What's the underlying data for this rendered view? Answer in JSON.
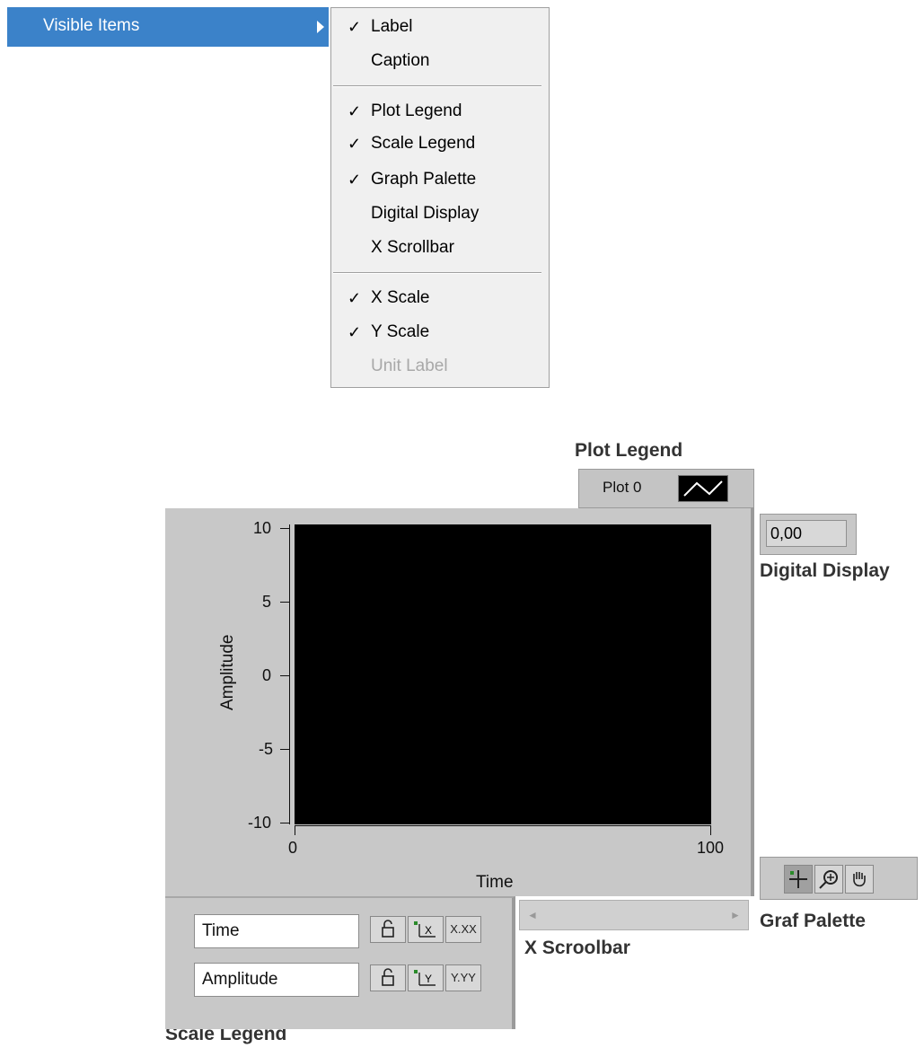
{
  "menu": {
    "parent_label": "Visible Items",
    "items": [
      {
        "label": "Label",
        "checked": true,
        "disabled": false
      },
      {
        "label": "Caption",
        "checked": false,
        "disabled": false
      },
      {
        "label": "Plot Legend",
        "checked": true,
        "disabled": false
      },
      {
        "label": "Scale Legend",
        "checked": true,
        "disabled": false
      },
      {
        "label": "Graph Palette",
        "checked": true,
        "disabled": false
      },
      {
        "label": "Digital Display",
        "checked": false,
        "disabled": false
      },
      {
        "label": "X Scrollbar",
        "checked": false,
        "disabled": false
      },
      {
        "label": "X Scale",
        "checked": true,
        "disabled": false
      },
      {
        "label": "Y Scale",
        "checked": true,
        "disabled": false
      },
      {
        "label": "Unit Label",
        "checked": false,
        "disabled": true
      }
    ],
    "check_glyph": "✓"
  },
  "captions": {
    "plot_legend": "Plot Legend",
    "digital_display": "Digital Display",
    "graf_palette": "Graf Palette",
    "x_scrollbar": "X Scroolbar",
    "scale_legend": "Scale Legend"
  },
  "graph": {
    "plot_name": "Plot 0",
    "digital_value": "0,00",
    "y_axis_label": "Amplitude",
    "x_axis_label": "Time",
    "y_ticks": [
      "10",
      "5",
      "0",
      "-5",
      "-10"
    ],
    "x_ticks": [
      "0",
      "100"
    ],
    "plot_background": "#000000"
  },
  "scale_legend": {
    "x_name": "Time",
    "y_name": "Amplitude",
    "x_format": "X.XX",
    "y_format": "Y.YY"
  },
  "palette": {
    "icons": [
      "crosshair-icon",
      "zoom-icon",
      "hand-icon"
    ]
  },
  "colors": {
    "menu_highlight": "#3b82c9"
  }
}
